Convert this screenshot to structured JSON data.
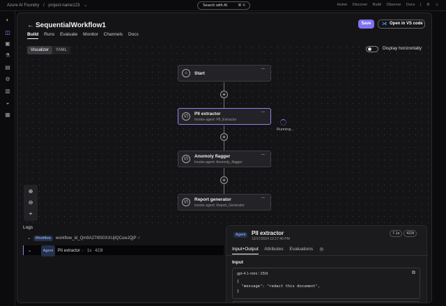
{
  "topbar": {
    "crumbs": [
      "Azure AI Foundry",
      "/",
      "project-name123",
      "⌄"
    ],
    "search": {
      "label": "Search with AI",
      "shortcut": "⌘ K"
    },
    "nav": [
      "Home",
      "Discover",
      "Build",
      "Observe",
      "Docs",
      "|",
      "⚙",
      "☺"
    ]
  },
  "header": {
    "title": "SequentialWorkflow1",
    "tabs": [
      "Build",
      "Runs",
      "Evaluate",
      "Monitor",
      "Channels",
      "Docs"
    ],
    "save_label": "Save",
    "vscode_label": "Open in VS code"
  },
  "canvas": {
    "view_tabs": [
      "Visualizer",
      "YAML"
    ],
    "toggle_label": "Display horizontally",
    "running_label": "Running...",
    "nodes": [
      {
        "title": "Start",
        "sub": ""
      },
      {
        "title": "PII extractor",
        "sub": "Invoke agent: PII_Extractor"
      },
      {
        "title": "Anomoly flagger",
        "sub": "Invoke agent: Anomoly_flagger"
      },
      {
        "title": "Report generator",
        "sub": "Invoke agent: Report_Generator"
      }
    ]
  },
  "logs": {
    "title": "Logs",
    "workflow_pill": "Workflow",
    "workflow_id": "workflow_id_Qm9A27I9S0XXUjIQCuwJQjP",
    "agent_pill": "Agent",
    "agent_name": "PII extractor",
    "agent_time": "1s",
    "agent_tokens": "423t"
  },
  "detail": {
    "pill": "Agent",
    "title": "PII extractor",
    "time": "12/17/2024 12:17:40 PM",
    "duration": "7.1s",
    "tokens": "423t",
    "tabs": [
      "Input+Output",
      "Attributes",
      "Evaluations"
    ],
    "eval_count": "0",
    "section": "Input",
    "model": "gpt-4.1-mini",
    "model_tokens": "250t",
    "code": "{\n  \"message\": \"redact this document\",\n}"
  }
}
